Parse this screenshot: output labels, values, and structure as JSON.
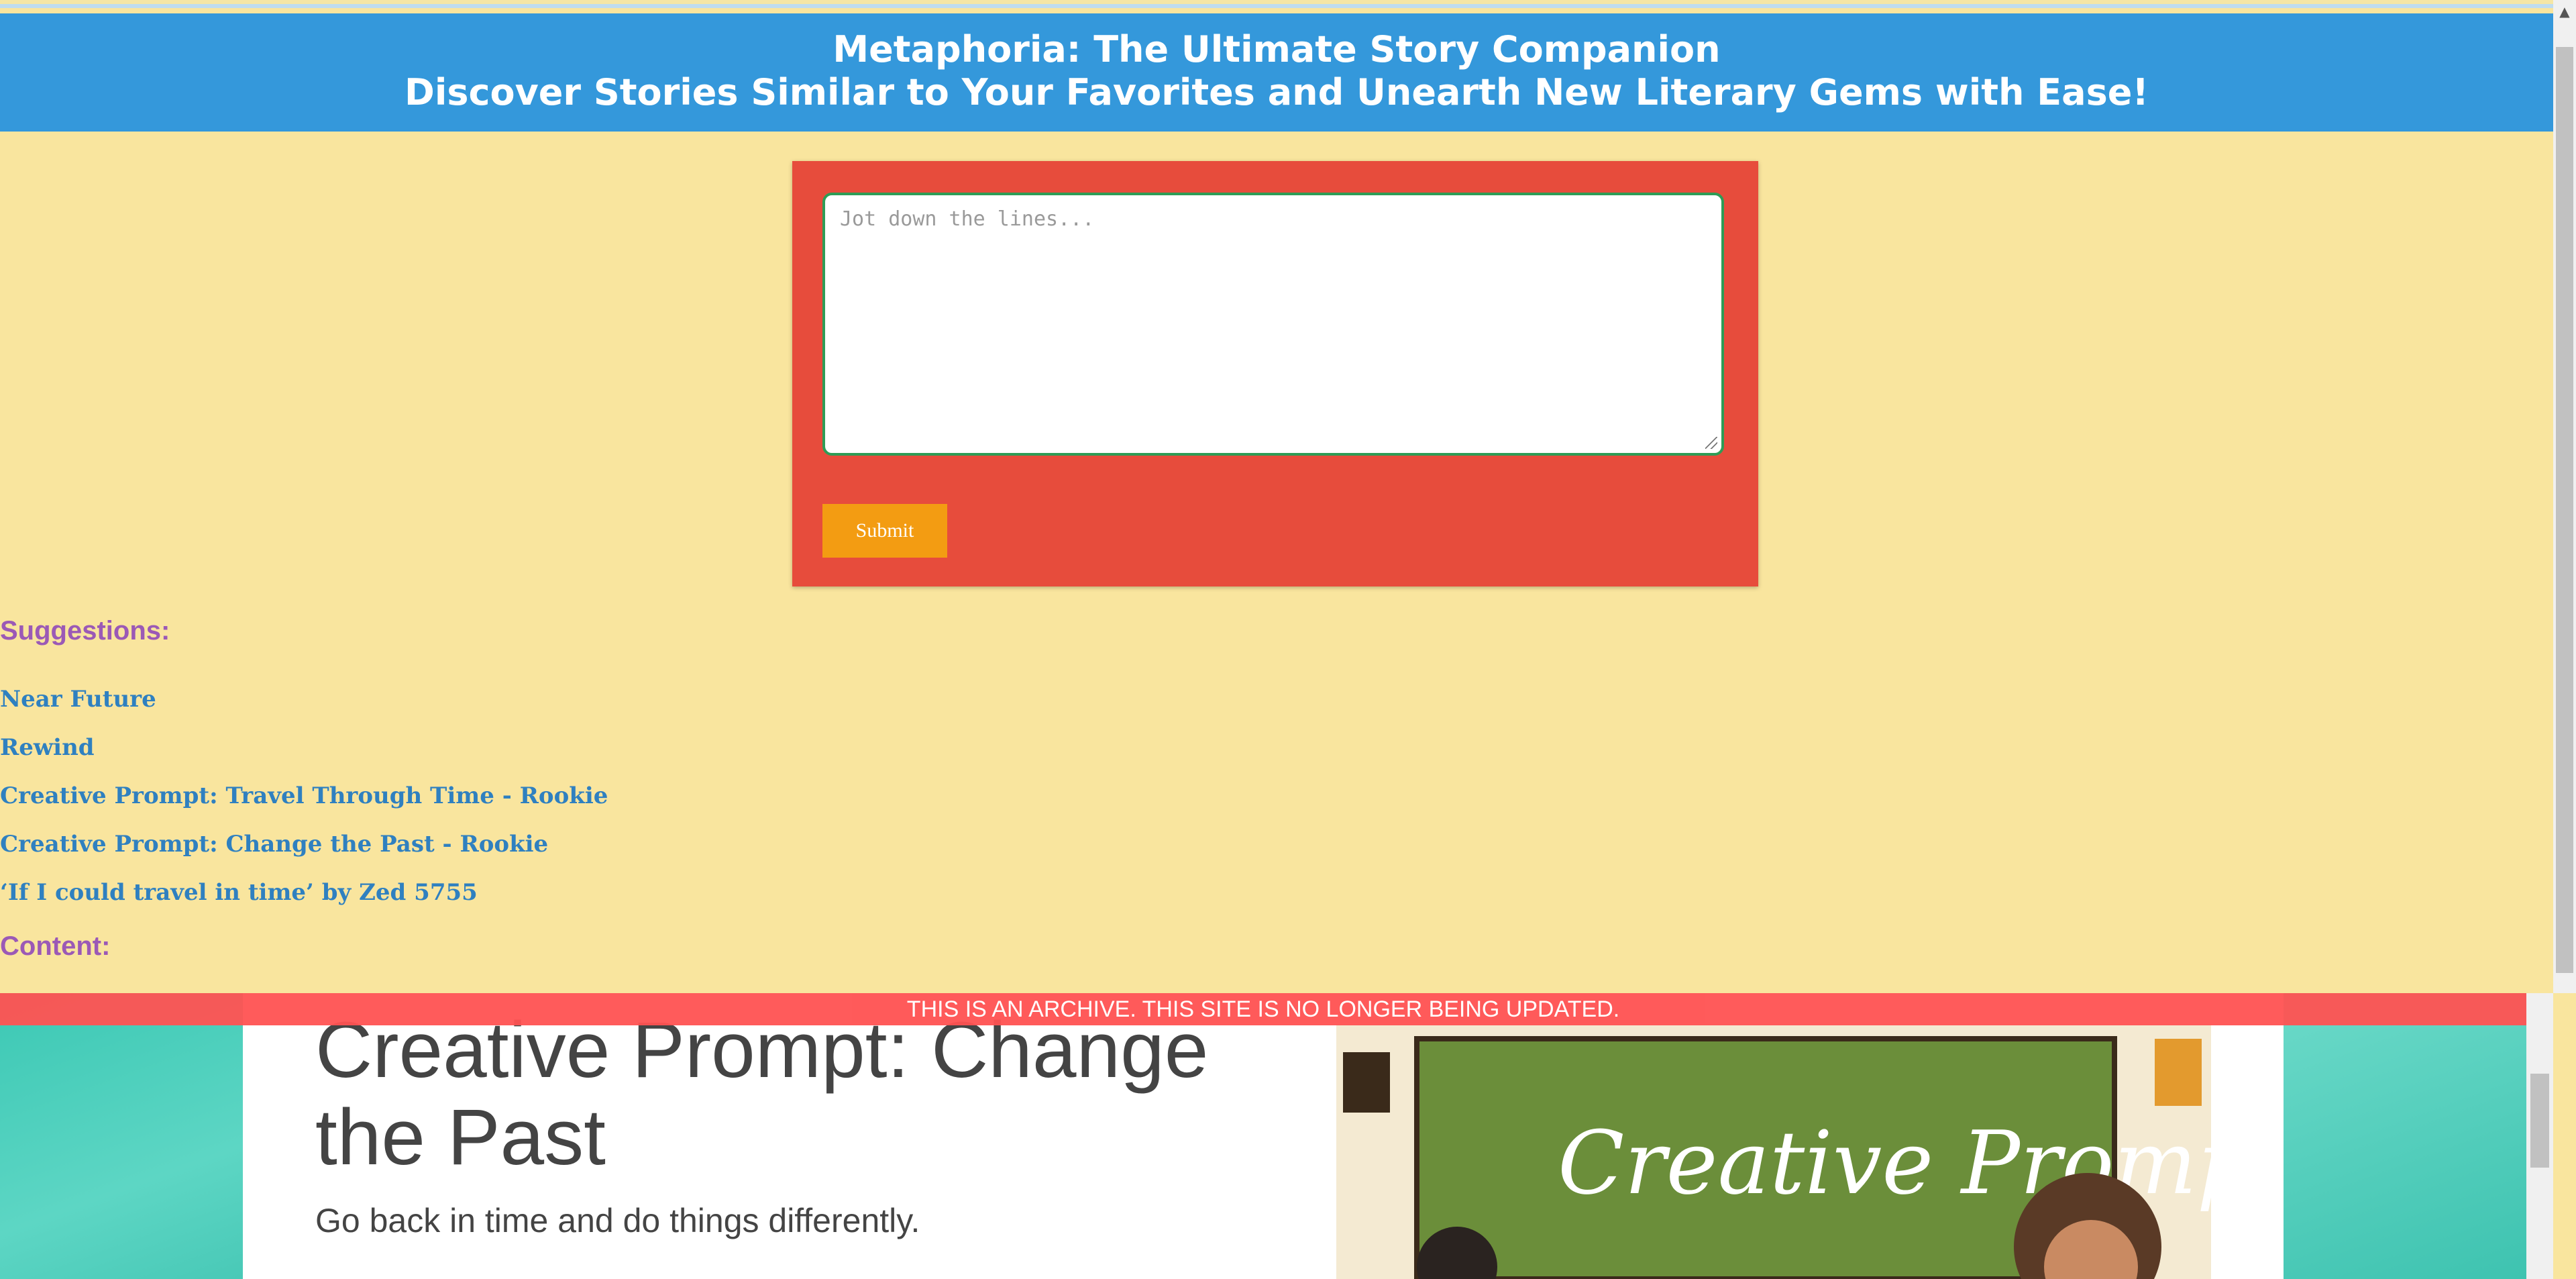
{
  "header": {
    "line1": "Metaphoria: The Ultimate Story Companion",
    "line2": "Discover Stories Similar to Your Favorites and Unearth New Literary Gems with Ease!"
  },
  "form": {
    "textarea_placeholder": "Jot down the lines...",
    "submit_label": "Submit"
  },
  "suggestions": {
    "heading": "Suggestions:",
    "items": [
      "Near Future",
      "Rewind",
      "Creative Prompt: Travel Through Time - Rookie",
      "Creative Prompt: Change the Past - Rookie",
      "‘If I could travel in time’ by Zed 5755"
    ]
  },
  "content": {
    "heading": "Content:",
    "archive_notice": "THIS IS AN ARCHIVE. THIS SITE IS NO LONGER BEING UPDATED.",
    "article_title": "Creative Prompt: Change the Past",
    "article_subtitle": "Go back in time and do things differently.",
    "image_text": "Creative Prompt!"
  },
  "colors": {
    "page_bg": "#f9e59e",
    "header_bg": "#3498db",
    "form_bg": "#e74c3c",
    "submit_bg": "#f39c12",
    "heading_color": "#9b59b6",
    "link_color": "#2f80c0",
    "archive_bar": "#ff5252"
  }
}
